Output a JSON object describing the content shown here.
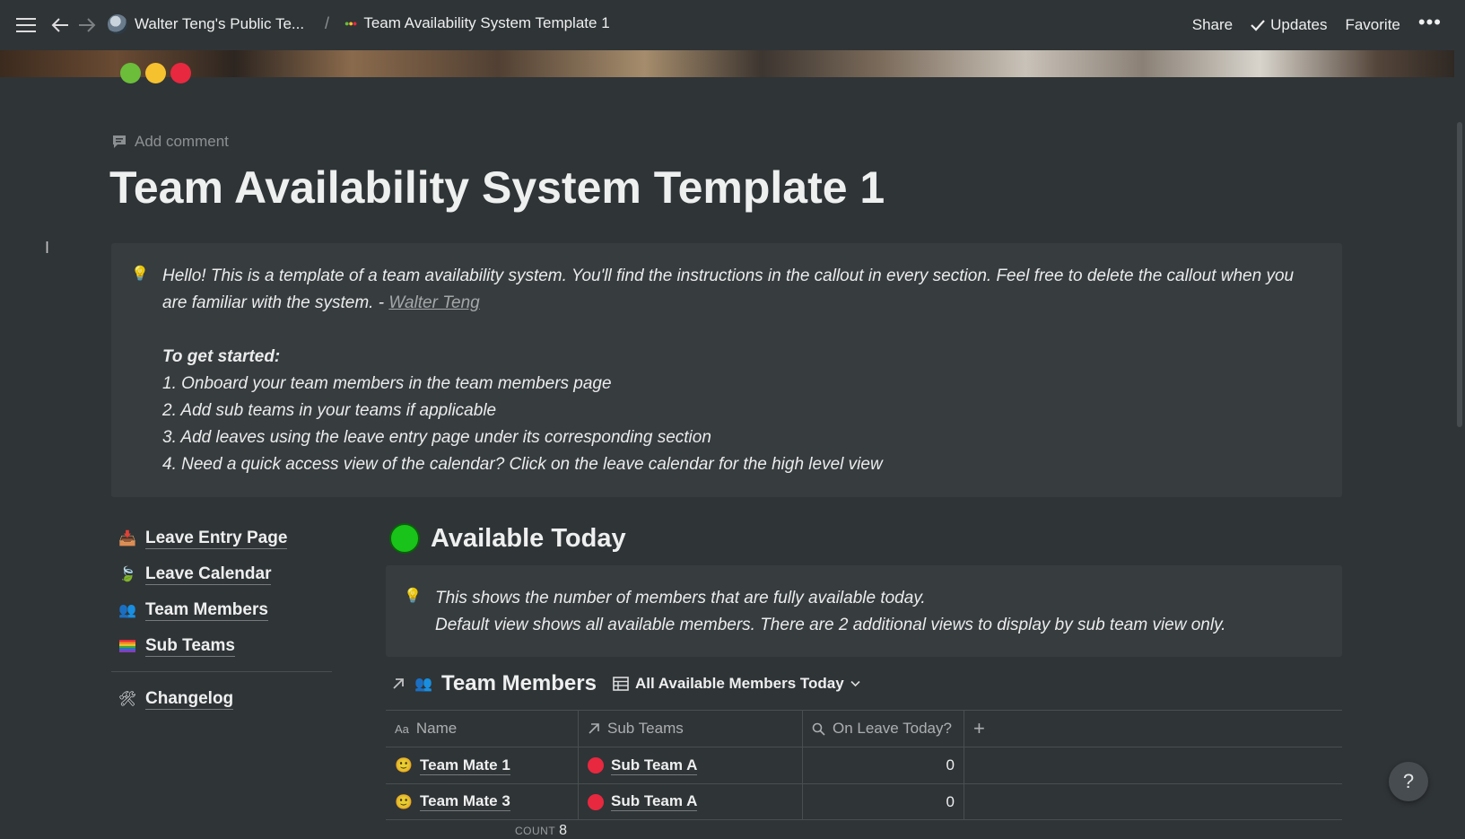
{
  "topbar": {
    "workspace": "Walter Teng's Public Te...",
    "separator": "/",
    "page": "Team Availability System Template 1",
    "share": "Share",
    "updates": "Updates",
    "favorite": "Favorite",
    "more": "•••"
  },
  "page": {
    "add_comment": "Add comment",
    "title": "Team Availability System Template 1"
  },
  "callout_main": {
    "line1": "Hello! This is a template of a team availability system. You'll find the instructions in the callout in every section. Feel free to delete the callout when you are familiar with the system. -",
    "author_link": "Walter Teng",
    "heading": "To get started:",
    "steps": [
      "1. Onboard your team members in the team members page",
      "2. Add sub teams in your teams if applicable",
      "3. Add leaves using the leave entry page under its corresponding section",
      "4. Need a quick access view of the calendar? Click on the leave calendar for the high level view"
    ]
  },
  "nav": {
    "items": [
      {
        "label": "Leave Entry Page",
        "icon": "inbox-tray-icon"
      },
      {
        "label": "Leave Calendar",
        "icon": "leaf-icon"
      },
      {
        "label": "Team Members",
        "icon": "people-icon"
      },
      {
        "label": "Sub Teams",
        "icon": "rainbow-flag-icon"
      }
    ],
    "changelog": {
      "label": "Changelog",
      "icon": "tools-icon"
    }
  },
  "available": {
    "heading": "Available Today",
    "callout_line1": "This shows the number of members that are fully available today.",
    "callout_line2": "Default view shows all available members. There are 2 additional views to display by sub team view only."
  },
  "database": {
    "title": "Team Members",
    "view": "All Available Members Today",
    "columns": [
      "Name",
      "Sub Teams",
      "On Leave Today?"
    ],
    "add_column": "+",
    "rows": [
      {
        "name": "Team Mate 1",
        "sub_team": "Sub Team A",
        "on_leave": "0"
      },
      {
        "name": "Team Mate 3",
        "sub_team": "Sub Team A",
        "on_leave": "0"
      }
    ],
    "count_label": "COUNT",
    "count_value": "8"
  },
  "help": "?",
  "colors": {
    "background": "#2f3437",
    "callout_bg": "#373c3f",
    "available_green": "#19c319",
    "sub_team_red": "#e8283f",
    "traffic_green": "#6bbd3a",
    "traffic_yellow": "#f5c12e",
    "traffic_red": "#e8283f"
  }
}
